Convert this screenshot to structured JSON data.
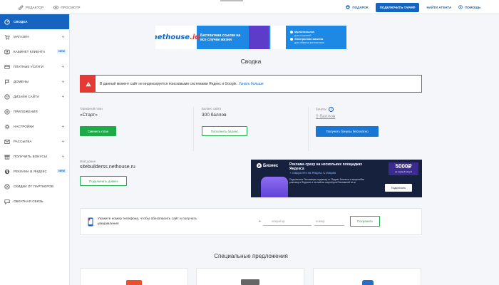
{
  "topbar": {
    "editor": "Редактор",
    "preview": "Просмотр",
    "gift": "Подарок",
    "connect_tariff": "Подключить тариф",
    "find_agent": "Найти агента",
    "help": "Помощь"
  },
  "sidebar": {
    "items": [
      {
        "label": "Сводка",
        "icon": "dashboard-icon",
        "active": true
      },
      {
        "label": "Магазин",
        "icon": "cart-icon",
        "chevron": true
      },
      {
        "label": "Кабинет клиента",
        "icon": "user-cabinet-icon",
        "badge": "NEW"
      },
      {
        "label": "Платные услуги",
        "icon": "paid-services-icon",
        "chevron": true
      },
      {
        "label": "Домены",
        "icon": "flag-icon",
        "chevron": true
      },
      {
        "label": "Дизайн сайта",
        "icon": "design-icon",
        "chevron": true
      },
      {
        "label": "Приложения",
        "icon": "apps-icon"
      },
      {
        "label": "Настройки",
        "icon": "gear-icon",
        "chevron": true
      },
      {
        "label": "Рассылка",
        "icon": "mail-icon",
        "chevron": true
      },
      {
        "label": "Получить бонусы",
        "icon": "gift-icon",
        "chevron": true
      },
      {
        "label": "Реклама в Яндекс",
        "icon": "yandex-icon",
        "badge": "NEW"
      },
      {
        "label": "Скидки от партнеров",
        "icon": "discount-icon"
      },
      {
        "label": "Обратная связь",
        "icon": "feedback-icon"
      }
    ]
  },
  "banner": {
    "logo": "nethouse",
    "logo_suffix": ".id",
    "text": "Бесплатная ссылка на все случаи жизни",
    "bullet1": "Мультиссылка",
    "bullet1_sub": "для соцсетей",
    "bullet2": "Электронная визитка",
    "bullet2_sub": "для обмена контактами"
  },
  "page_title": "Сводка",
  "alert": {
    "text": "В данный момент сайт не индексируется поисковыми системами Яндекс и Google.",
    "link": "Узнать больше"
  },
  "stats": {
    "tariff_label": "Тарифный план",
    "tariff_value": "«Старт»",
    "tariff_button": "Сменить план",
    "balance_label": "Баланс сайта",
    "balance_value": "300 баллов",
    "balance_button": "Пополнить баланс",
    "bonus_label": "Бонусы",
    "bonus_value": "0 баллов",
    "bonus_button": "Получить бонусы бесплатно"
  },
  "domain": {
    "label": "Мой домен",
    "value": "sitebuilderss.nethouse.ru",
    "button": "Подключить домен"
  },
  "ad": {
    "logo": "Бизнес",
    "title": "Реклама сразу на нескольких площадках Яндекса",
    "title_sub": "+ скидка 5% на Яндекс Станцию",
    "desc": "Подключите Рекламную подписку от Яндекс Бизнеса и запускайте рекламу в Яндексе и на сайтах партнёров Рекламной сети",
    "price": "5000₽",
    "price_sub": "на первый запуск",
    "button": "Подключить"
  },
  "phone": {
    "text": "Укажите номер телефона, чтобы обезопасить сайт и получать уведомления",
    "plus": "+",
    "operator_placeholder": "оператор",
    "number_placeholder": "номер",
    "button": "Сохранить"
  },
  "offers_title": "Специальные предложения",
  "colors": {
    "primary": "#1565c0",
    "green": "#1faa4a",
    "red": "#e53935"
  }
}
